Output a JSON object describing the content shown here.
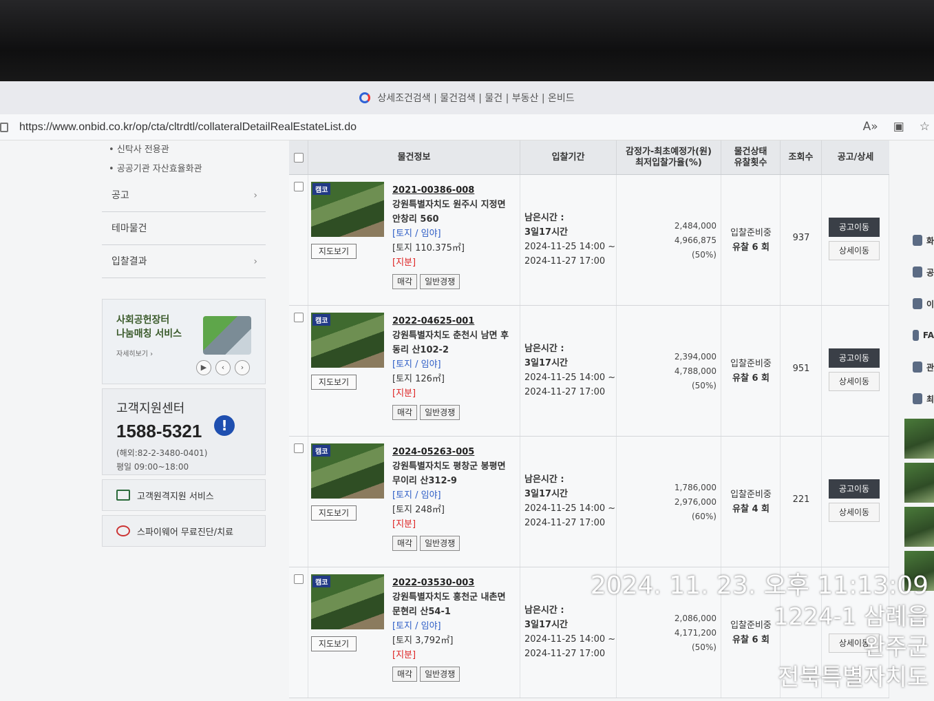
{
  "browser": {
    "tab_title": "상세조건검색 | 물건검색 | 물건 | 부동산 | 온비드",
    "url": "https://www.onbid.co.kr/op/cta/cltrdtl/collateralDetailRealEstateList.do"
  },
  "sidebar": {
    "sub_links": [
      "신탁사 전용관",
      "공공기관 자산효율화관"
    ],
    "menu": [
      {
        "label": "공고",
        "chevron": true
      },
      {
        "label": "테마물건",
        "chevron": false
      },
      {
        "label": "입찰결과",
        "chevron": true
      }
    ],
    "banner": {
      "title": "사회공헌장터\n나눔매칭 서비스",
      "more": "자세히보기"
    },
    "support": {
      "title": "고객지원센터",
      "phone": "1588-5321",
      "overseas": "(해외:82-2-3480-0401)",
      "hours": "평일 09:00~18:00"
    },
    "buttons": [
      "고객원격지원 서비스",
      "스파이웨어 무료진단/치료"
    ]
  },
  "table": {
    "headers": [
      "물건정보",
      "입찰기간",
      "감정가-최초예정가(원)\n최저입찰가율(%)",
      "물건상태\n유찰횟수",
      "조회수",
      "공고/상세"
    ],
    "rows": [
      {
        "badge": "캠코",
        "id": "2021-00386-008",
        "address": "강원특별자치도 원주시 지정면 안창리 560",
        "category": "[토지 / 임야]",
        "area": "[토지 110.375㎡]",
        "share": "[지분]",
        "tags": [
          "매각",
          "일반경쟁"
        ],
        "remain_label": "남은시간 :",
        "remain": "3일17시간",
        "start": "2024-11-25 14:00 ~",
        "end": "2024-11-27 17:00",
        "appraisal": "2,484,000",
        "min_price": "4,966,875",
        "rate": "(50%)",
        "status": "입찰준비중",
        "fails": "유찰 6 회",
        "views": "937",
        "btn_notice": "공고이동",
        "btn_detail": "상세이동"
      },
      {
        "badge": "캠코",
        "id": "2022-04625-001",
        "address": "강원특별자치도 춘천시 남면 후동리 산102-2",
        "category": "[토지 / 임야]",
        "area": "[토지 126㎡]",
        "share": "[지분]",
        "tags": [
          "매각",
          "일반경쟁"
        ],
        "remain_label": "남은시간 :",
        "remain": "3일17시간",
        "start": "2024-11-25 14:00 ~",
        "end": "2024-11-27 17:00",
        "appraisal": "2,394,000",
        "min_price": "4,788,000",
        "rate": "(50%)",
        "status": "입찰준비중",
        "fails": "유찰 6 회",
        "views": "951",
        "btn_notice": "공고이동",
        "btn_detail": "상세이동"
      },
      {
        "badge": "캠코",
        "id": "2024-05263-005",
        "address": "강원특별자치도 평창군 봉평면 무이리 산312-9",
        "category": "[토지 / 임야]",
        "area": "[토지 248㎡]",
        "share": "[지분]",
        "tags": [
          "매각",
          "일반경쟁"
        ],
        "remain_label": "남은시간 :",
        "remain": "3일17시간",
        "start": "2024-11-25 14:00 ~",
        "end": "2024-11-27 17:00",
        "appraisal": "1,786,000",
        "min_price": "2,976,000",
        "rate": "(60%)",
        "status": "입찰준비중",
        "fails": "유찰 4 회",
        "views": "221",
        "btn_notice": "공고이동",
        "btn_detail": "상세이동"
      },
      {
        "badge": "캠코",
        "id": "2022-03530-003",
        "address": "강원특별자치도 홍천군 내촌면 문현리 산54-1",
        "category": "[토지 / 임야]",
        "area": "[토지 3,792㎡]",
        "share": "[지분]",
        "tags": [
          "매각",
          "일반경쟁"
        ],
        "remain_label": "남은시간 :",
        "remain": "3일17시간",
        "start": "2024-11-25 14:00 ~",
        "end": "2024-11-27 17:00",
        "appraisal": "2,086,000",
        "min_price": "4,171,200",
        "rate": "(50%)",
        "status": "입찰준비중",
        "fails": "유찰 6 회",
        "views": "",
        "btn_notice": "",
        "btn_detail": "상세이동"
      }
    ]
  },
  "quick_panel": [
    "화",
    "공",
    "이",
    "FA",
    "관",
    "최"
  ],
  "overlay": {
    "datetime": "2024. 11. 23. 오후 11:13:09",
    "line2": "1224-1 삼례읍",
    "line3": "완주군",
    "line4": "전북특별자치도"
  }
}
